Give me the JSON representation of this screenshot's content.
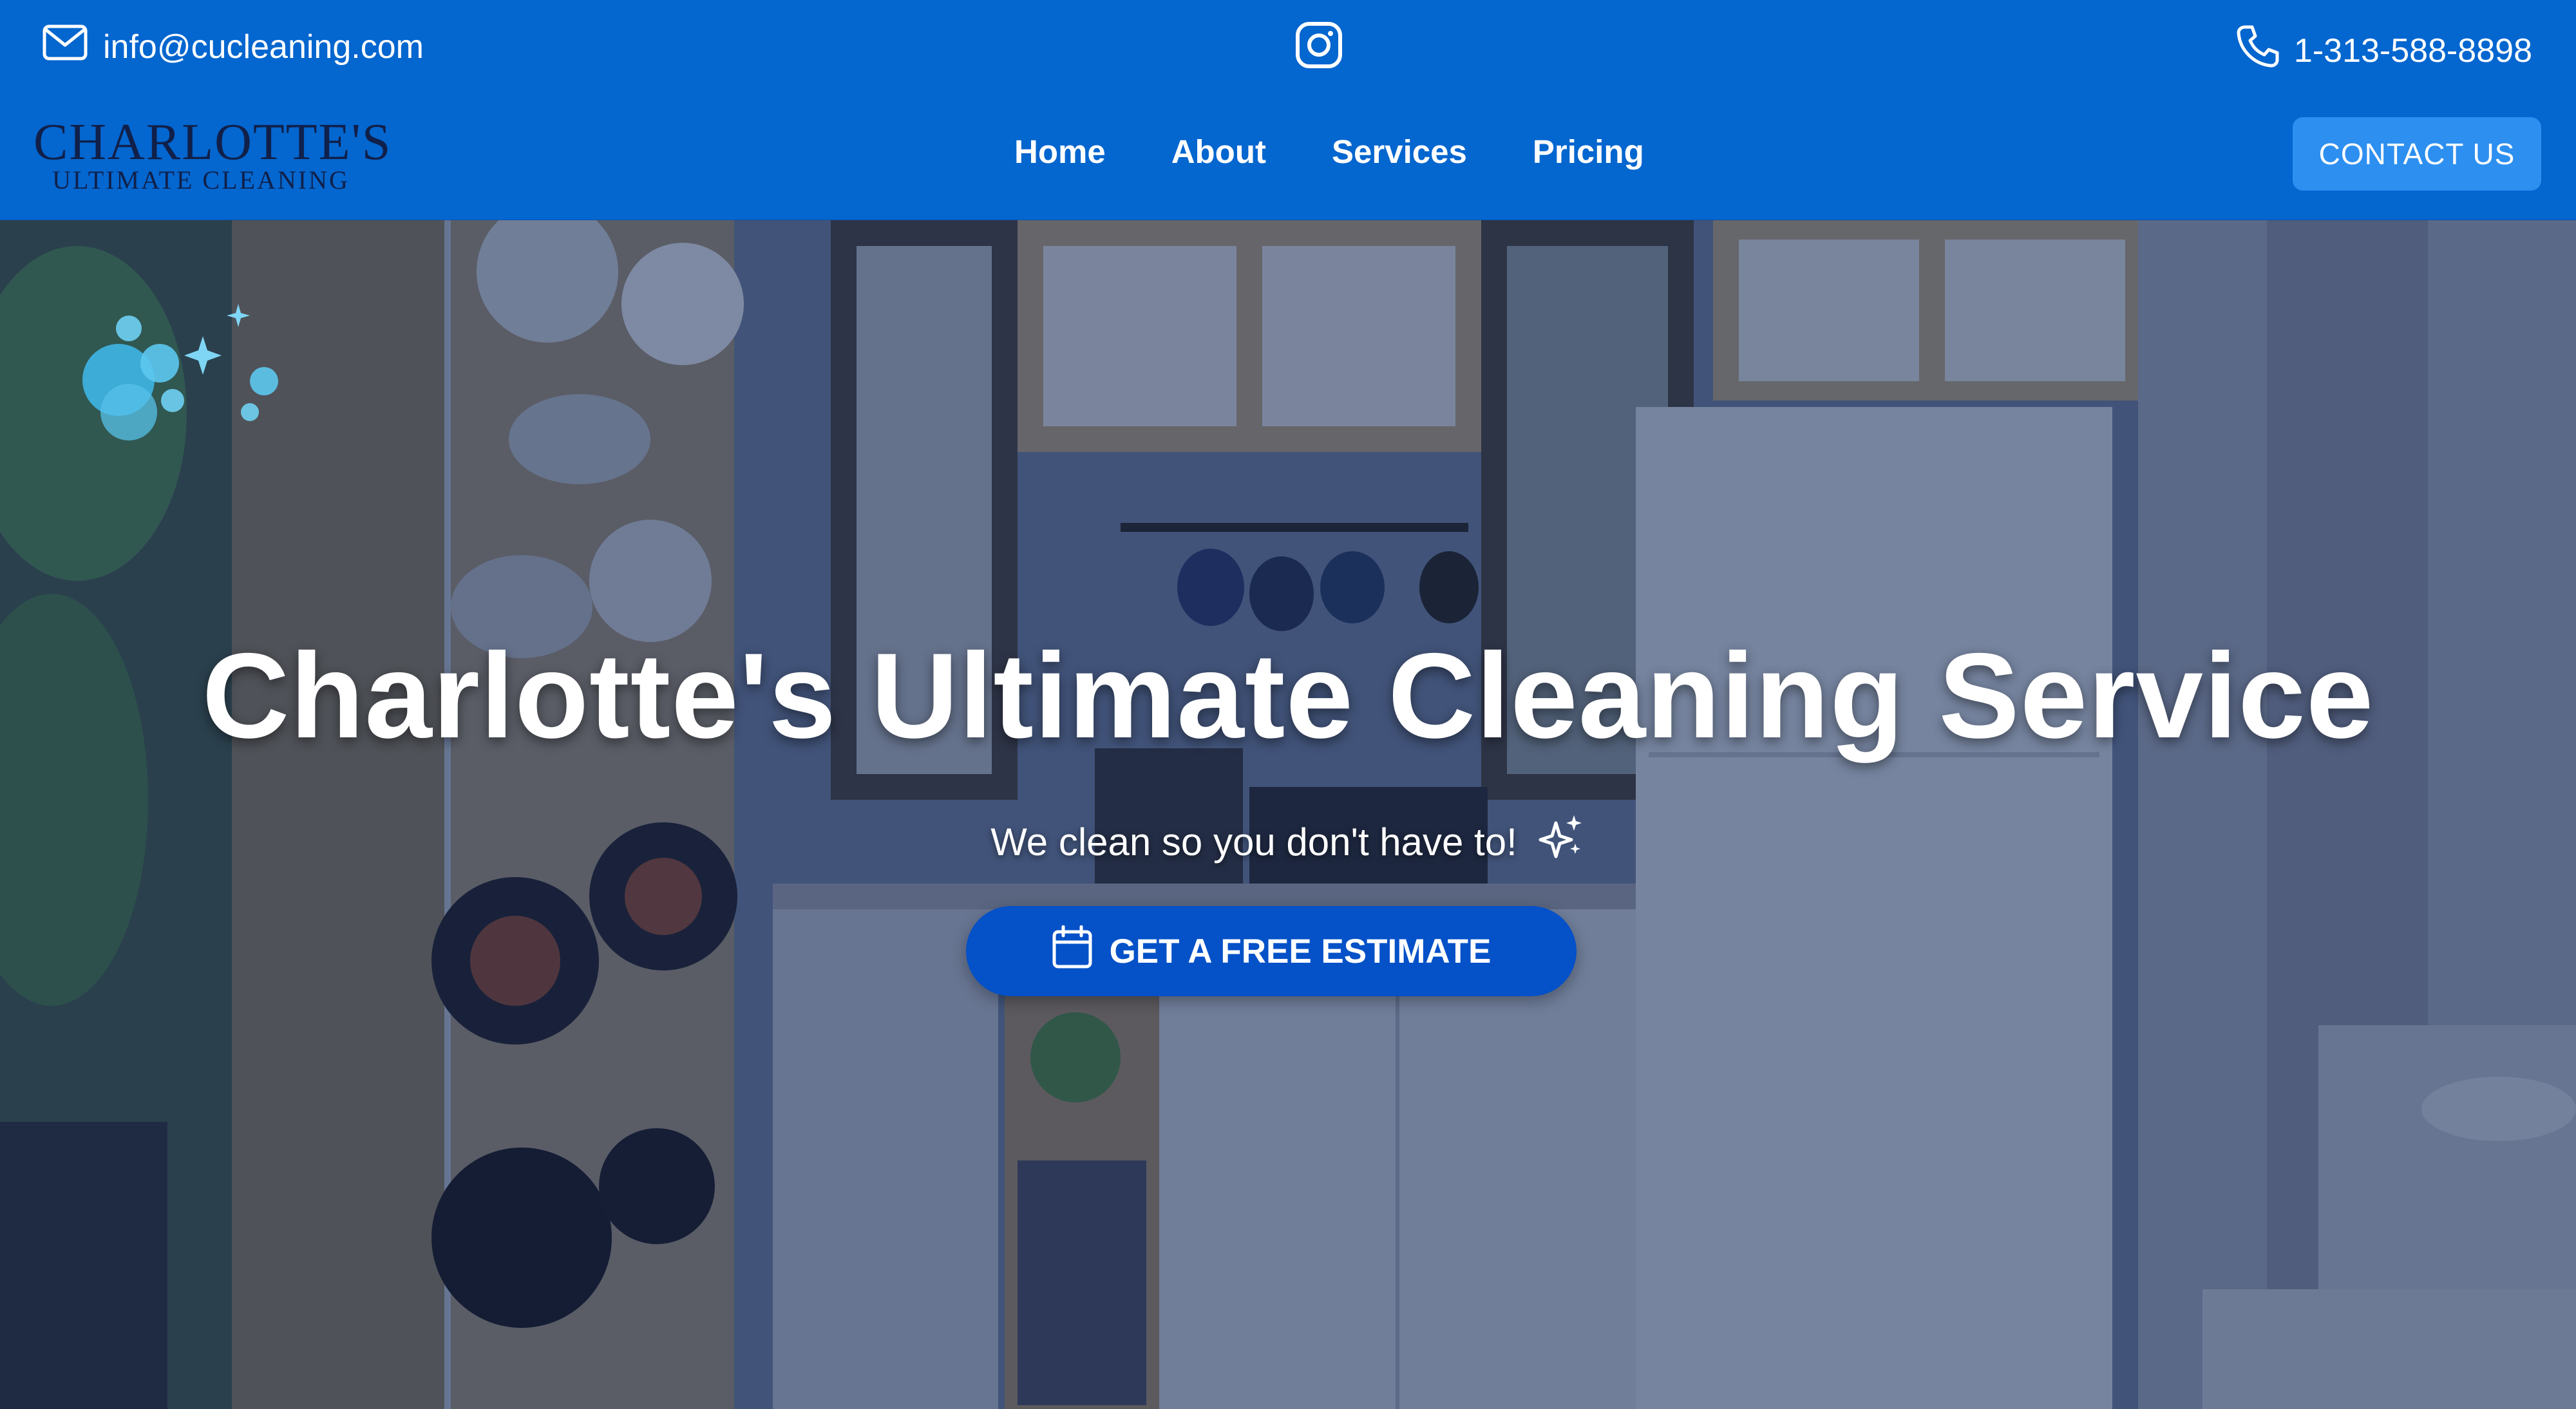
{
  "topbar": {
    "email": "info@cucleaning.com",
    "phone": "1-313-588-8898",
    "instagram_icon": "instagram-icon",
    "mail_icon": "mail-icon",
    "phone_icon": "phone-icon"
  },
  "nav": {
    "logo_line1": "CHARLOTTE'S",
    "logo_line2": "ULTIMATE CLEANING",
    "links": [
      "Home",
      "About",
      "Services",
      "Pricing"
    ],
    "contact_label": "CONTACT US"
  },
  "hero": {
    "title": "Charlotte's Ultimate Cleaning Service",
    "subtitle": "We clean so you don't have to!",
    "sparkle_icon": "sparkle-icon",
    "cta_label": "GET A FREE ESTIMATE",
    "cta_icon": "calendar-icon"
  },
  "colors": {
    "brand_blue": "#0466cf",
    "cta_blue": "#0451c8",
    "contact_blue": "#2d8ff0",
    "bubble": "#3fb6e6"
  }
}
